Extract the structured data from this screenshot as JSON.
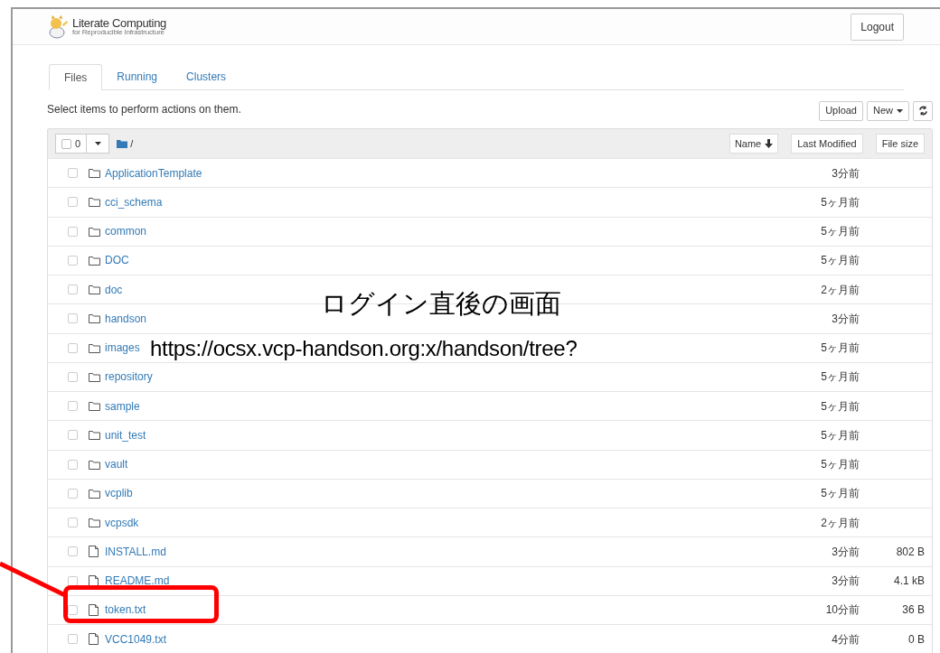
{
  "header": {
    "logo_title": "Literate Computing",
    "logo_subtitle": "for Reproducible Infrastructure",
    "logout": "Logout"
  },
  "tabs": [
    {
      "label": "Files",
      "selected": true
    },
    {
      "label": "Running",
      "selected": false
    },
    {
      "label": "Clusters",
      "selected": false
    }
  ],
  "toolbar": {
    "hint": "Select items to perform actions on them.",
    "upload": "Upload",
    "new": "New"
  },
  "list_header": {
    "select_all_checked": false,
    "selected_count": "0",
    "path": "/",
    "sort_name": "Name",
    "sort_modified": "Last Modified",
    "sort_size": "File size"
  },
  "rows": [
    {
      "kind": "folder",
      "name": "ApplicationTemplate",
      "modified": "3分前",
      "checked": false
    },
    {
      "kind": "folder",
      "name": "cci_schema",
      "modified": "5ヶ月前",
      "checked": false
    },
    {
      "kind": "folder",
      "name": "common",
      "modified": "5ヶ月前",
      "checked": false
    },
    {
      "kind": "folder",
      "name": "DOC",
      "modified": "5ヶ月前",
      "checked": false
    },
    {
      "kind": "folder",
      "name": "doc",
      "modified": "2ヶ月前",
      "checked": false
    },
    {
      "kind": "folder",
      "name": "handson",
      "modified": "3分前",
      "checked": false
    },
    {
      "kind": "folder",
      "name": "images",
      "modified": "5ヶ月前",
      "checked": false
    },
    {
      "kind": "folder",
      "name": "repository",
      "modified": "5ヶ月前",
      "checked": false
    },
    {
      "kind": "folder",
      "name": "sample",
      "modified": "5ヶ月前",
      "checked": false
    },
    {
      "kind": "folder",
      "name": "unit_test",
      "modified": "5ヶ月前",
      "checked": false
    },
    {
      "kind": "folder",
      "name": "vault",
      "modified": "5ヶ月前",
      "checked": false
    },
    {
      "kind": "folder",
      "name": "vcplib",
      "modified": "5ヶ月前",
      "checked": false
    },
    {
      "kind": "folder",
      "name": "vcpsdk",
      "modified": "2ヶ月前",
      "checked": false
    },
    {
      "kind": "file",
      "name": "INSTALL.md",
      "modified": "3分前",
      "size": "802 B",
      "checked": false
    },
    {
      "kind": "file",
      "name": "README.md",
      "modified": "3分前",
      "size": "4.1 kB",
      "checked": false
    },
    {
      "kind": "file",
      "name": "token.txt",
      "modified": "10分前",
      "size": "36 B",
      "checked": false
    },
    {
      "kind": "file",
      "name": "VCC1049.txt",
      "modified": "4分前",
      "size": "0 B",
      "checked": false
    }
  ],
  "annotation": {
    "caption": "ログイン直後の画面",
    "url": "https://ocsx.vcp-handson.org:x/handson/tree?"
  }
}
